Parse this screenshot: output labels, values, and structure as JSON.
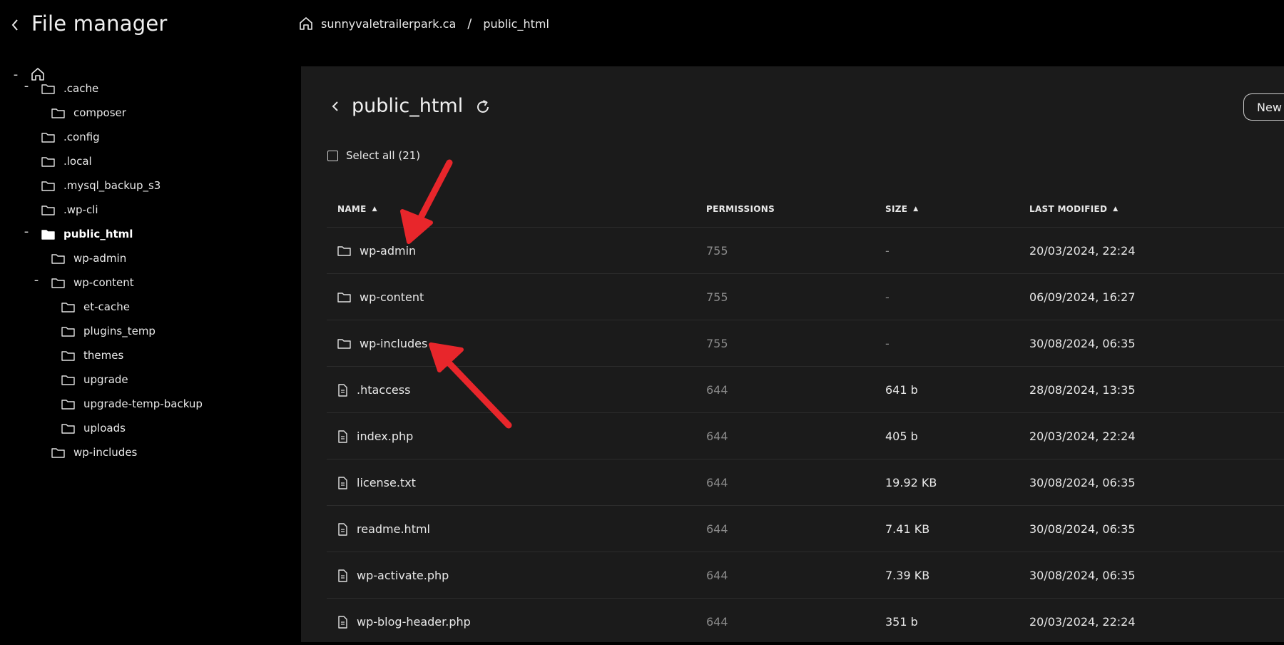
{
  "header": {
    "title": "File manager",
    "breadcrumbs": [
      "sunnyvaletrailerpark.ca",
      "public_html"
    ],
    "separator": "/"
  },
  "sidebar": {
    "items": [
      {
        "label": ".cache",
        "toggle": "-"
      },
      {
        "label": "composer"
      },
      {
        "label": ".config"
      },
      {
        "label": ".local"
      },
      {
        "label": ".mysql_backup_s3"
      },
      {
        "label": ".wp-cli"
      },
      {
        "label": "public_html",
        "toggle": "-",
        "active": true
      },
      {
        "label": "wp-admin"
      },
      {
        "label": "wp-content",
        "toggle": "-"
      },
      {
        "label": "et-cache"
      },
      {
        "label": "plugins_temp"
      },
      {
        "label": "themes"
      },
      {
        "label": "upgrade"
      },
      {
        "label": "upgrade-temp-backup"
      },
      {
        "label": "uploads"
      },
      {
        "label": "wp-includes"
      }
    ],
    "root_toggle": "-"
  },
  "main": {
    "title": "public_html",
    "new_button": "New",
    "select_all": "Select all (21)",
    "columns": {
      "name": "NAME",
      "permissions": "PERMISSIONS",
      "size": "SIZE",
      "modified": "LAST MODIFIED"
    },
    "rows": [
      {
        "name": "wp-admin",
        "type": "folder",
        "permissions": "755",
        "size": "-",
        "modified": "20/03/2024, 22:24"
      },
      {
        "name": "wp-content",
        "type": "folder",
        "permissions": "755",
        "size": "-",
        "modified": "06/09/2024, 16:27"
      },
      {
        "name": "wp-includes",
        "type": "folder",
        "permissions": "755",
        "size": "-",
        "modified": "30/08/2024, 06:35"
      },
      {
        "name": ".htaccess",
        "type": "file",
        "permissions": "644",
        "size": "641 b",
        "modified": "28/08/2024, 13:35"
      },
      {
        "name": "index.php",
        "type": "file",
        "permissions": "644",
        "size": "405 b",
        "modified": "20/03/2024, 22:24"
      },
      {
        "name": "license.txt",
        "type": "file",
        "permissions": "644",
        "size": "19.92 KB",
        "modified": "30/08/2024, 06:35"
      },
      {
        "name": "readme.html",
        "type": "file",
        "permissions": "644",
        "size": "7.41 KB",
        "modified": "30/08/2024, 06:35"
      },
      {
        "name": "wp-activate.php",
        "type": "file",
        "permissions": "644",
        "size": "7.39 KB",
        "modified": "30/08/2024, 06:35"
      },
      {
        "name": "wp-blog-header.php",
        "type": "file",
        "permissions": "644",
        "size": "351 b",
        "modified": "20/03/2024, 22:24"
      }
    ]
  },
  "colors": {
    "background": "#000000",
    "panel": "#1b1b1b",
    "annotation_arrow": "#e8262b"
  }
}
